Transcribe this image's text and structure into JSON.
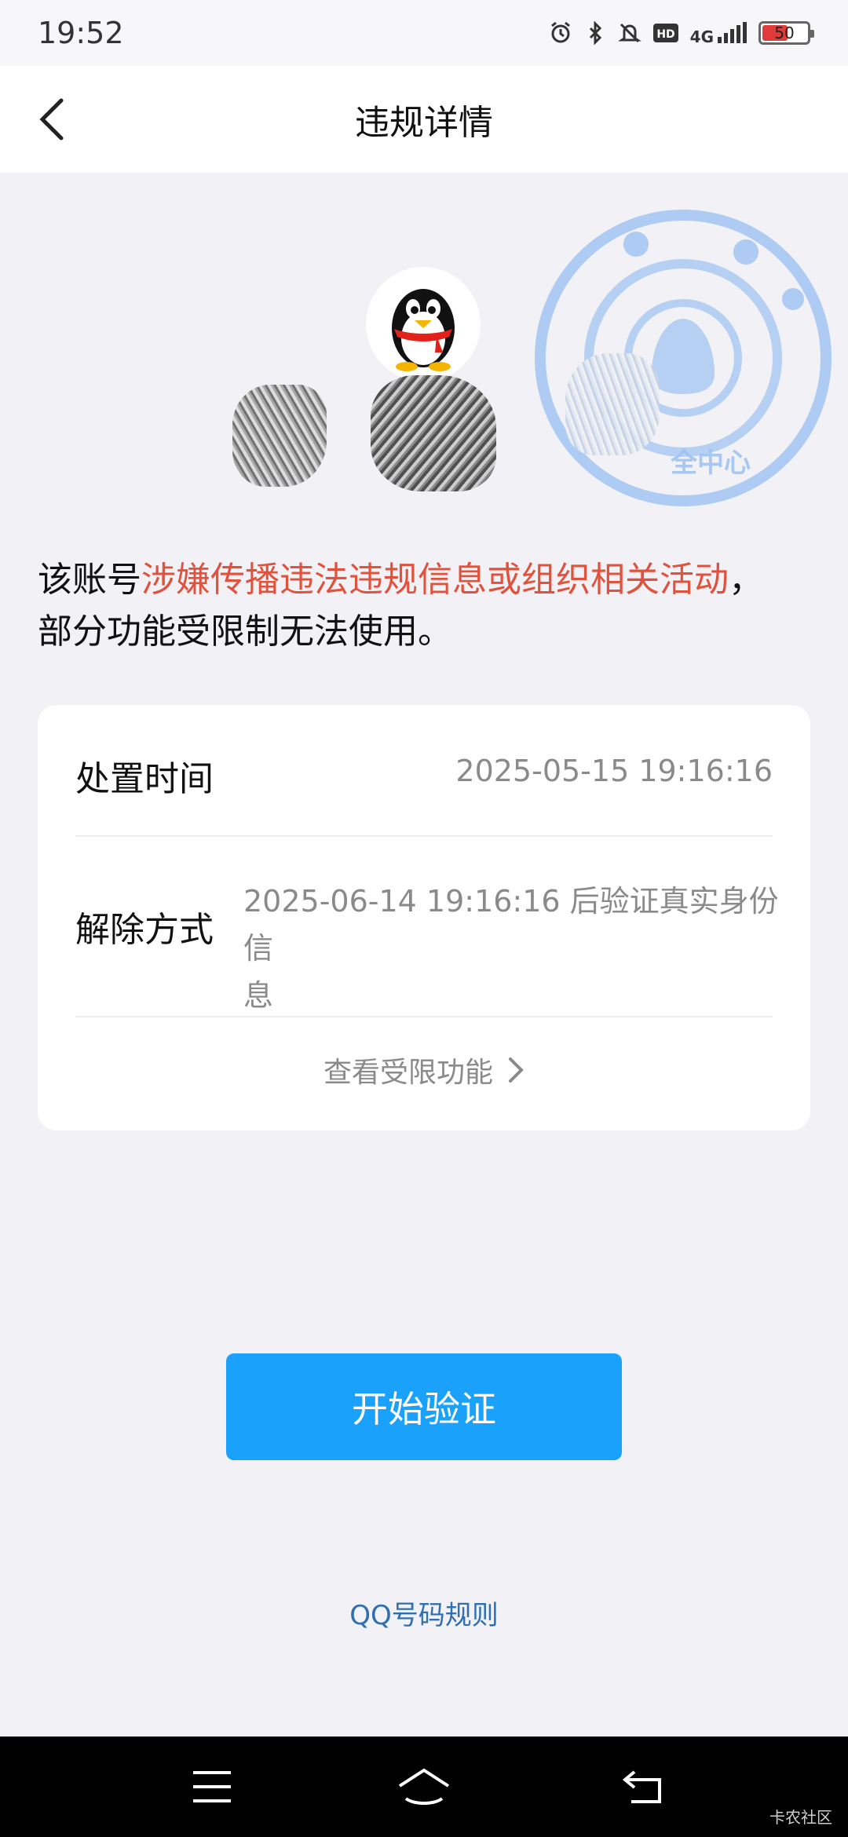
{
  "status_bar": {
    "time": "19:52",
    "icons": [
      "alarm-icon",
      "bluetooth-icon",
      "mute-icon",
      "hd-icon",
      "signal-4g-icon",
      "battery-icon"
    ],
    "network_label": "4G",
    "hd_label": "HD",
    "battery_level": "50"
  },
  "nav": {
    "title": "违规详情",
    "back_icon": "chevron-left-icon"
  },
  "header": {
    "avatar_icon": "qq-penguin-icon",
    "stamp_text": "全中心"
  },
  "notice": {
    "prefix": "该账号",
    "highlight": "涉嫌传播违法违规信息或组织相关活动",
    "suffix_punct": "，",
    "line2": "部分功能受限制无法使用。",
    "highlight_color": "#e1523d"
  },
  "details": {
    "disposal_time_label": "处置时间",
    "disposal_time_value": "2025-05-15 19:16:16",
    "release_method_label": "解除方式",
    "release_method_value_line1": "2025-06-14 19:16:16 后验证真实身份信",
    "release_method_value_line2": "息",
    "view_limits_link": "查看受限功能"
  },
  "actions": {
    "start_verify_button": "开始验证",
    "button_color": "#1aa1fb",
    "rules_link": "QQ号码规则"
  },
  "system_nav": {
    "buttons": [
      "menu-icon",
      "home-icon",
      "back-icon"
    ],
    "watermark": "卡农社区"
  }
}
